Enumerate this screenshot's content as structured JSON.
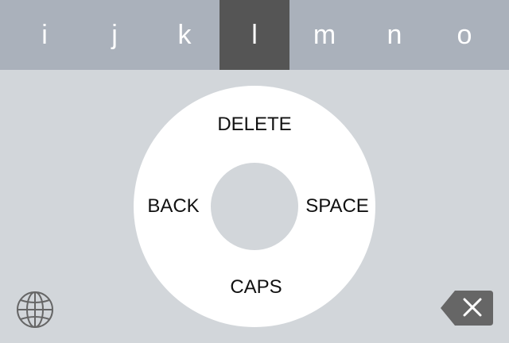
{
  "letter_strip": {
    "letters": [
      "i",
      "j",
      "k",
      "l",
      "m",
      "n",
      "o"
    ],
    "selected": "l"
  },
  "wheel": {
    "top_label": "DELETE",
    "left_label": "BACK",
    "right_label": "SPACE",
    "bottom_label": "CAPS"
  },
  "icons": {
    "globe": "globe-icon",
    "backspace": "backspace-icon"
  },
  "colors": {
    "background": "#d2d6da",
    "strip_background": "#aab1bb",
    "selected_key": "#555555",
    "letter_text": "#ffffff",
    "wheel": "#ffffff",
    "icon": "#666666"
  }
}
